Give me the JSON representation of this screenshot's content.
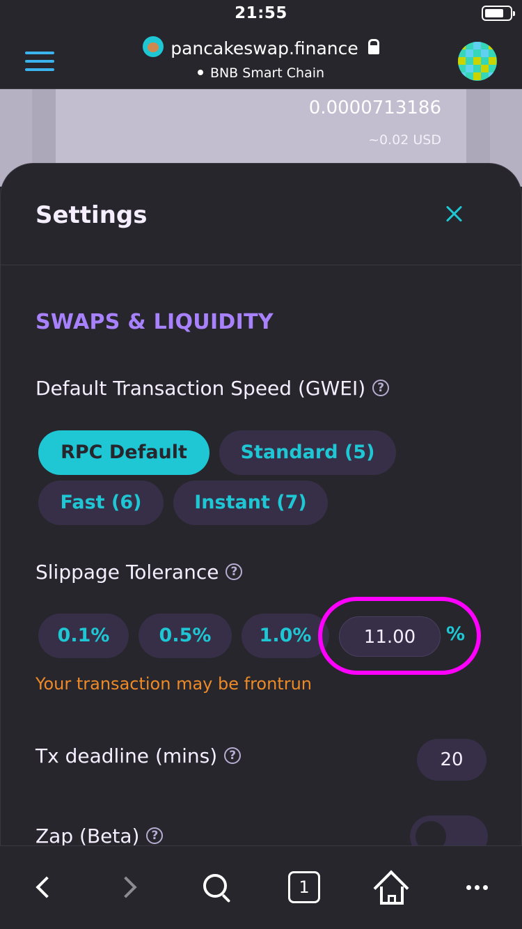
{
  "status_bar": {
    "time": "21:55"
  },
  "browser": {
    "url": "pancakeswap.finance",
    "network": "BNB Smart Chain"
  },
  "background_page": {
    "amount": "0.0000713186",
    "usd_value": "~0.02 USD"
  },
  "settings": {
    "title": "Settings",
    "section_heading": "SWAPS & LIQUIDITY",
    "gas": {
      "label": "Default Transaction Speed (GWEI)",
      "options": [
        {
          "label": "RPC Default",
          "active": true
        },
        {
          "label": "Standard (5)",
          "active": false
        },
        {
          "label": "Fast (6)",
          "active": false
        },
        {
          "label": "Instant (7)",
          "active": false
        }
      ]
    },
    "slippage": {
      "label": "Slippage Tolerance",
      "options": [
        "0.1%",
        "0.5%",
        "1.0%"
      ],
      "custom_value": "11.00",
      "unit": "%",
      "warning": "Your transaction may be frontrun"
    },
    "deadline": {
      "label": "Tx deadline (mins)",
      "value": "20"
    },
    "zap": {
      "label": "Zap (Beta)",
      "enabled": false
    },
    "help_glyph": "?"
  },
  "toolbar": {
    "tab_count": "1"
  },
  "colors": {
    "background": "#27262c",
    "accent": "#1fc7d4",
    "heading_purple": "#a881fc",
    "warning": "#ed8a28",
    "highlight": "#ff00ff"
  }
}
